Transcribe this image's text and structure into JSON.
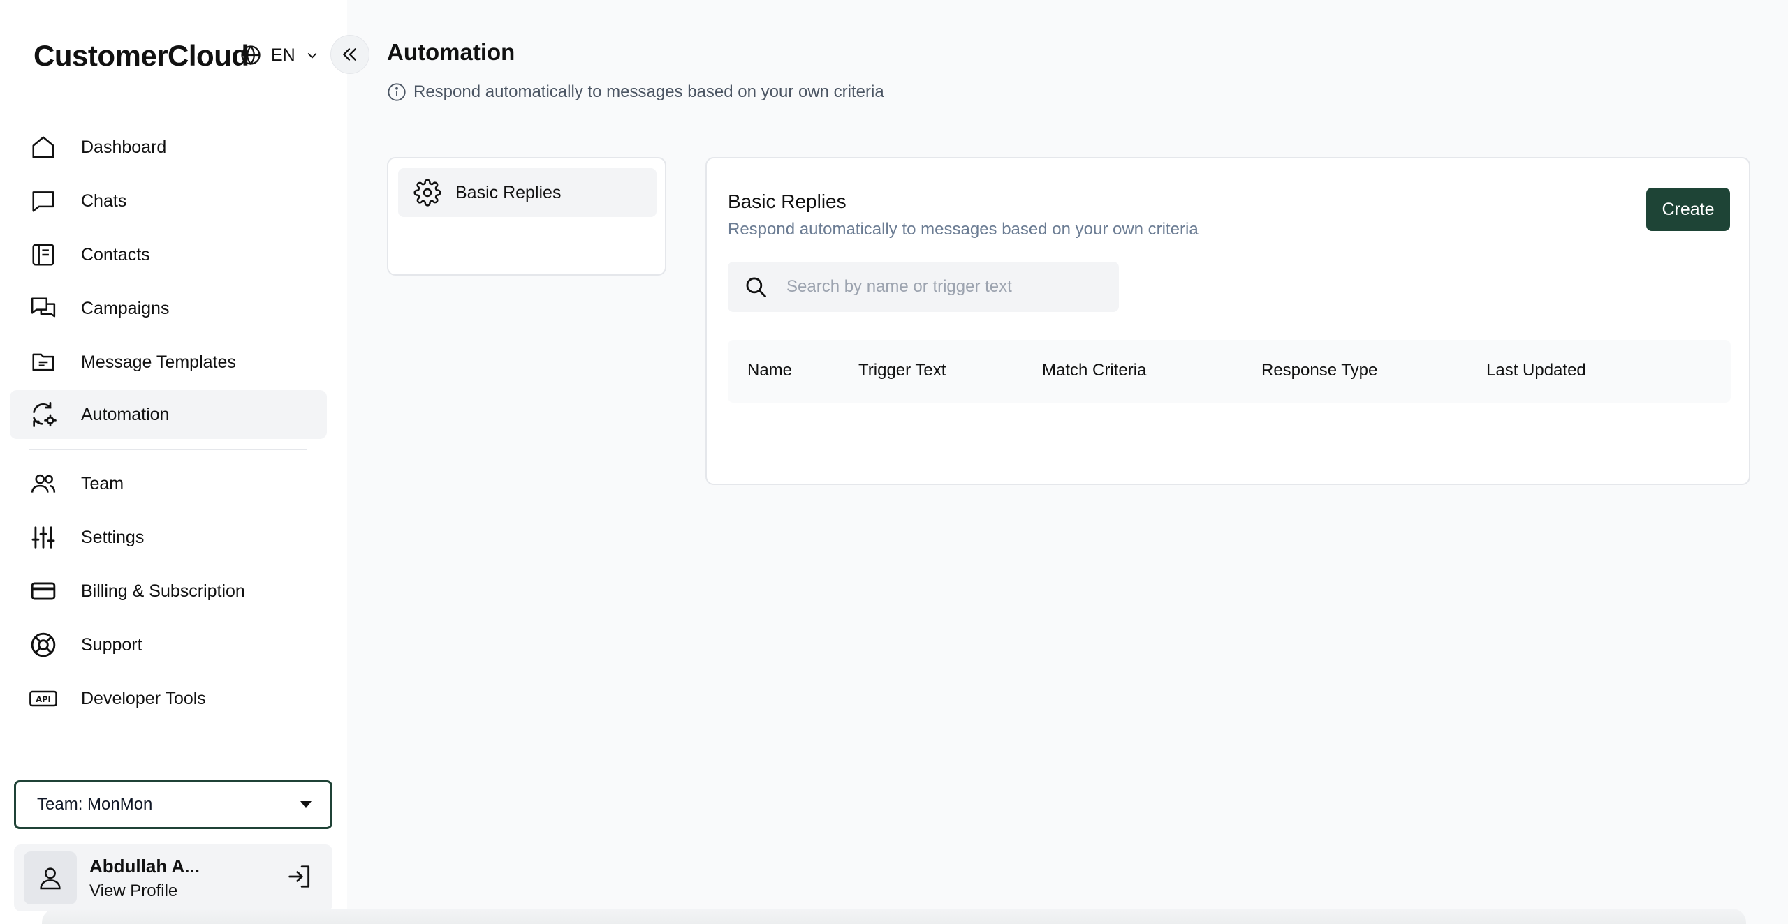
{
  "brand": "CustomerCloud",
  "language": "EN",
  "nav": [
    {
      "label": "Dashboard",
      "icon": "home-icon"
    },
    {
      "label": "Chats",
      "icon": "chat-icon"
    },
    {
      "label": "Contacts",
      "icon": "contacts-icon"
    },
    {
      "label": "Campaigns",
      "icon": "campaigns-icon"
    },
    {
      "label": "Message Templates",
      "icon": "folder-icon"
    },
    {
      "label": "Automation",
      "icon": "automation-icon",
      "active": true
    },
    {
      "label": "Team",
      "icon": "team-icon"
    },
    {
      "label": "Settings",
      "icon": "sliders-icon"
    },
    {
      "label": "Billing & Subscription",
      "icon": "card-icon"
    },
    {
      "label": "Support",
      "icon": "lifebuoy-icon"
    },
    {
      "label": "Developer Tools",
      "icon": "api-icon"
    }
  ],
  "team_select": "Team: MonMon",
  "profile": {
    "name": "Abdullah A...",
    "link": "View Profile"
  },
  "page": {
    "title": "Automation",
    "subtitle": "Respond automatically to messages based on your own criteria"
  },
  "subnav": {
    "label": "Basic Replies"
  },
  "card": {
    "title": "Basic Replies",
    "subtitle": "Respond automatically to messages based on your own criteria",
    "create_label": "Create",
    "search_placeholder": "Search by name or trigger text",
    "columns": [
      "Name",
      "Trigger Text",
      "Match Criteria",
      "Response Type",
      "Last Updated"
    ]
  },
  "colors": {
    "accent": "#1e4436",
    "active_bg": "#f3f4f6"
  }
}
